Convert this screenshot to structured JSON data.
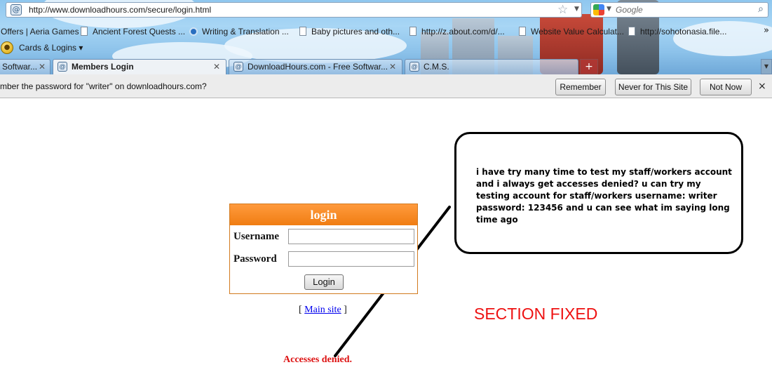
{
  "browser": {
    "url": "http://www.downloadhours.com/secure/login.html",
    "search_placeholder": "Google",
    "bookmarks": [
      "Offers | Aeria Games",
      "Ancient Forest Quests ...",
      "Writing & Translation ...",
      "Baby pictures and oth...",
      "http://z.about.com/d/...",
      "Website Value Calculat...",
      "http://sohotonasia.file..."
    ],
    "cards_label": "Cards & Logins",
    "tabs": [
      {
        "label": "Softwar...",
        "active": false
      },
      {
        "label": "Members Login",
        "active": true
      },
      {
        "label": "DownloadHours.com - Free Softwar...",
        "active": false
      },
      {
        "label": "C.M.S.",
        "active": false
      }
    ],
    "new_tab_symbol": "+",
    "overflow_symbol": "»"
  },
  "notification": {
    "text": "mber the password for \"writer\" on downloadhours.com?",
    "remember": "Remember",
    "never": "Never for This Site",
    "not_now": "Not Now",
    "close": "×"
  },
  "login": {
    "title": "login",
    "username_label": "Username",
    "password_label": "Password",
    "username_value": "",
    "password_value": "",
    "button": "Login",
    "main_site_prefix": "[ ",
    "main_site_link": "Main site",
    "main_site_suffix": " ]",
    "error": "Accesses denied."
  },
  "annotation": {
    "bubble_text": "i have try many time to test my staff/workers account and i always get accesses denied? u can try my testing account for staff/workers username: writer password: 123456 and u can see what im saying long time ago",
    "section_note": "SECTION FIXED"
  }
}
